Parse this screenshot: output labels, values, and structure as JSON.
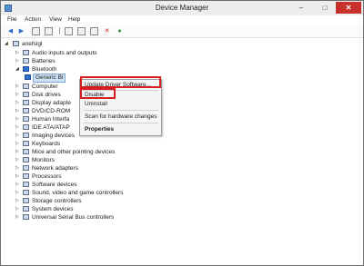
{
  "window": {
    "title": "Device Manager",
    "controls": {
      "minimize": "–",
      "maximize": "□",
      "close": "✕"
    }
  },
  "menu": [
    "File",
    "Action",
    "View",
    "Help"
  ],
  "toolbar": [
    "back",
    "forward",
    "properties",
    "help",
    "scan",
    "update",
    "disable",
    "uninstall"
  ],
  "tree": {
    "root": "ariefsigl",
    "nodes": [
      {
        "label": "Audio inputs and outputs",
        "icon": "speaker-icon",
        "state": "collapsed"
      },
      {
        "label": "Batteries",
        "icon": "battery-icon",
        "state": "collapsed"
      },
      {
        "label": "Bluetooth",
        "icon": "bluetooth-icon",
        "state": "expanded"
      },
      {
        "label": "Generic Bl",
        "icon": "bluetooth-device-icon",
        "state": "child-selected"
      },
      {
        "label": "Computer",
        "icon": "computer-icon",
        "state": "collapsed"
      },
      {
        "label": "Disk drives",
        "icon": "disk-icon",
        "state": "collapsed"
      },
      {
        "label": "Display adapte",
        "icon": "display-icon",
        "state": "collapsed"
      },
      {
        "label": "DVD/CD-ROM",
        "icon": "dvd-icon",
        "state": "collapsed"
      },
      {
        "label": "Human Interfa",
        "icon": "hid-icon",
        "state": "collapsed"
      },
      {
        "label": "IDE ATA/ATAP",
        "icon": "ide-icon",
        "state": "collapsed"
      },
      {
        "label": "Imaging devices",
        "icon": "camera-icon",
        "state": "collapsed"
      },
      {
        "label": "Keyboards",
        "icon": "keyboard-icon",
        "state": "collapsed"
      },
      {
        "label": "Mice and other pointing devices",
        "icon": "mouse-icon",
        "state": "collapsed"
      },
      {
        "label": "Monitors",
        "icon": "monitor-icon",
        "state": "collapsed"
      },
      {
        "label": "Network adapters",
        "icon": "network-icon",
        "state": "collapsed"
      },
      {
        "label": "Processors",
        "icon": "cpu-icon",
        "state": "collapsed"
      },
      {
        "label": "Software devices",
        "icon": "software-icon",
        "state": "collapsed"
      },
      {
        "label": "Sound, video and game controllers",
        "icon": "sound-icon",
        "state": "collapsed"
      },
      {
        "label": "Storage controllers",
        "icon": "storage-icon",
        "state": "collapsed"
      },
      {
        "label": "System devices",
        "icon": "system-icon",
        "state": "collapsed"
      },
      {
        "label": "Universal Serial Bus controllers",
        "icon": "usb-icon",
        "state": "collapsed"
      }
    ]
  },
  "context_menu": {
    "items": [
      {
        "label": "Update Driver Software...",
        "highlighted": true
      },
      {
        "label": "Disable",
        "highlighted": true
      },
      {
        "label": "Uninstall"
      },
      {
        "label": "Scan for hardware changes"
      },
      {
        "label": "Properties",
        "bold": true
      }
    ]
  },
  "colors": {
    "highlight_box": "#d61e1e",
    "close_button": "#c7302b",
    "selection": "#cfe3f7"
  }
}
